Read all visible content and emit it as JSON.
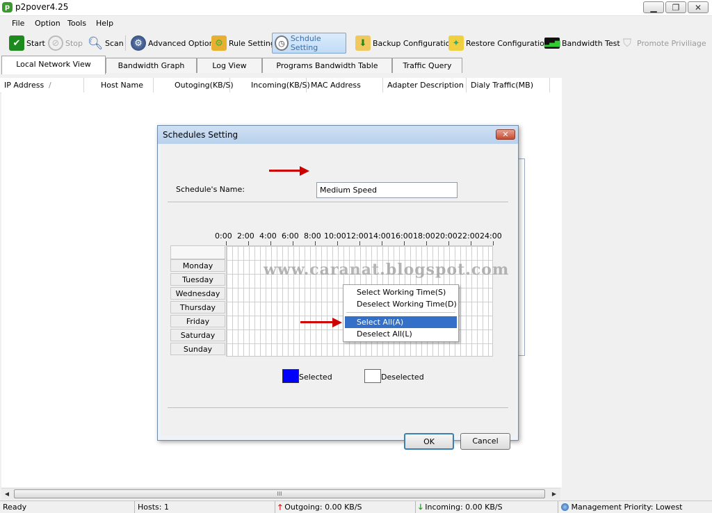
{
  "window": {
    "title": "p2pover4.25",
    "minimize": "▁",
    "restore": "❐",
    "close": "✕"
  },
  "menu": [
    "File",
    "Option",
    "Tools",
    "Help"
  ],
  "toolbar": {
    "start": "Start",
    "stop": "Stop",
    "scan": "Scan",
    "advanced": "Advanced Option",
    "rule": "Rule Setting",
    "schedule": "Schdule Setting",
    "backup": "Backup Configuration",
    "restore": "Restore Configuration",
    "bandwidth_test": "Bandwidth Test",
    "promote": "Promote Priviliage"
  },
  "tabs": [
    "Local Network View",
    "Bandwidth Graph",
    "Log View",
    "Programs Bandwidth Table",
    "Traffic Query"
  ],
  "columns": [
    "IP Address",
    "Host Name",
    "Outoging(KB/S)",
    "Incoming(KB/S)",
    "MAC Address",
    "Adapter Description",
    "Dialy Traffic(MB)"
  ],
  "sort_indicator": "/",
  "dialog": {
    "title": "Schedules Setting",
    "close": "✕",
    "name_label": "Schedule's Name:",
    "name_value": "Medium Speed",
    "hours": [
      "0:00",
      "2:00",
      "4:00",
      "6:00",
      "8:00",
      "10:00",
      "12:00",
      "14:00",
      "16:00",
      "18:00",
      "20:00",
      "22:00",
      "24:00"
    ],
    "days": [
      "Monday",
      "Tuesday",
      "Wednesday",
      "Thursday",
      "Friday",
      "Saturday",
      "Sunday"
    ],
    "watermark": "www.caranat.blogspot.com",
    "legend_selected": "Selected",
    "legend_deselected": "Deselected",
    "ok": "OK",
    "cancel": "Cancel",
    "selected_color": "#0000ff"
  },
  "context_menu": {
    "items": [
      "Select Working Time(S)",
      "Deselect Working Time(D)",
      "Select All(A)",
      "Deselect All(L)"
    ],
    "highlighted": "Select All(A)"
  },
  "scrollbar": {
    "left": "◀",
    "right": "▶",
    "grip": "III"
  },
  "status": {
    "ready": "Ready",
    "hosts": "Hosts: 1",
    "outgoing": "Outgoing: 0.00 KB/S",
    "incoming": "Incoming: 0.00 KB/S",
    "priority": "Management Priority: Lowest"
  },
  "icons": {
    "up_arrow": "#e00000",
    "down_arrow": "#1a8a1a"
  }
}
